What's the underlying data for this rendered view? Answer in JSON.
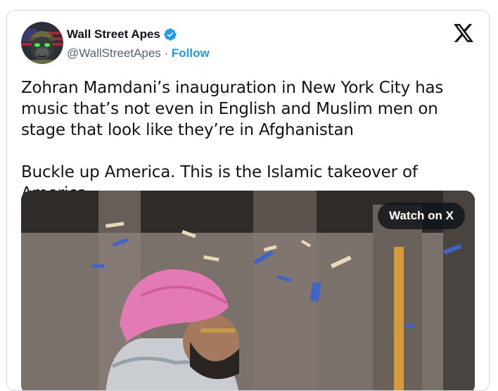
{
  "author": {
    "display_name": "Wall Street Apes",
    "handle": "@WallStreetApes",
    "separator": " · ",
    "follow_label": "Follow",
    "verified": true,
    "avatar_icon": "gorilla-avatar-icon"
  },
  "tweet": {
    "text": "Zohran Mamdani’s inauguration in New York City has music that’s not even in English and Muslim men on stage that look like they’re in Afghanistan\n\nBuckle up America. This is the Islamic takeover of America"
  },
  "media": {
    "watch_label": "Watch on X"
  },
  "colors": {
    "accent": "#1d9bf0",
    "text": "#0f1419",
    "muted": "#536471",
    "border": "#cfd9de"
  }
}
